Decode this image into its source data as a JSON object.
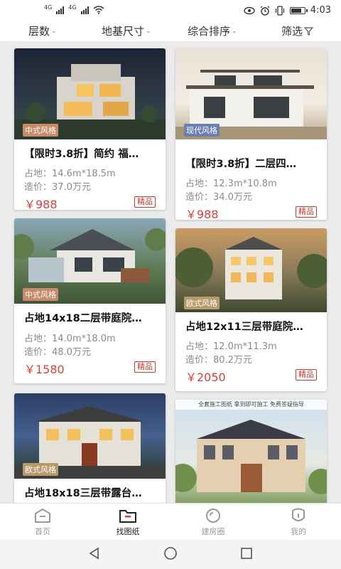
{
  "status_bar": {
    "net1": "4G",
    "net2": "4G",
    "time": "4:03"
  },
  "filters": [
    {
      "label": "层数",
      "caret": "⌄"
    },
    {
      "label": "地基尺寸",
      "caret": "⌄"
    },
    {
      "label": "综合排序",
      "caret": "⌄"
    },
    {
      "label": "筛选",
      "icon": "filter-icon"
    }
  ],
  "cards": [
    {
      "tag": "中式风格",
      "tag_color": "#c98a6a",
      "title": "【限时3.8折】简约 福…",
      "area": "占地：14.6m*18.5m",
      "cost": "造价：37.0万元",
      "price": "￥988",
      "badge": "精品"
    },
    {
      "tag": "现代风格",
      "tag_color": "#6b7fb0",
      "title": "【限时3.8折】二层四…",
      "area": "占地：12.3m*10.8m",
      "cost": "造价：34.0万元",
      "price": "￥988",
      "badge": "精品"
    },
    {
      "tag": "中式风格",
      "tag_color": "#c98a6a",
      "title": "占地14x18二层带庭院…",
      "area": "占地：14.0m*18.0m",
      "cost": "造价：48.0万元",
      "price": "￥1580",
      "badge": "精品"
    },
    {
      "tag": "欧式风格",
      "tag_color": "#b89a6a",
      "title": "占地12x11三层带庭院…",
      "area": "占地：12.0m*11.3m",
      "cost": "造价：80.2万元",
      "price": "￥2050",
      "badge": "精品"
    },
    {
      "tag": "欧式风格",
      "tag_color": "#b89a6a",
      "title": "占地18x18三层带露台…"
    },
    {
      "banner": "全套施工图纸   拿到即可施工   免费答疑指导"
    }
  ],
  "tabbar": [
    {
      "label": "首页",
      "icon": "home-icon"
    },
    {
      "label": "找图纸",
      "icon": "folder-icon",
      "active": true
    },
    {
      "label": "建房圈",
      "icon": "circle-icon"
    },
    {
      "label": "我的",
      "icon": "user-icon"
    }
  ],
  "colors": {
    "accent": "#d5413b",
    "badge": "#c0392b"
  }
}
